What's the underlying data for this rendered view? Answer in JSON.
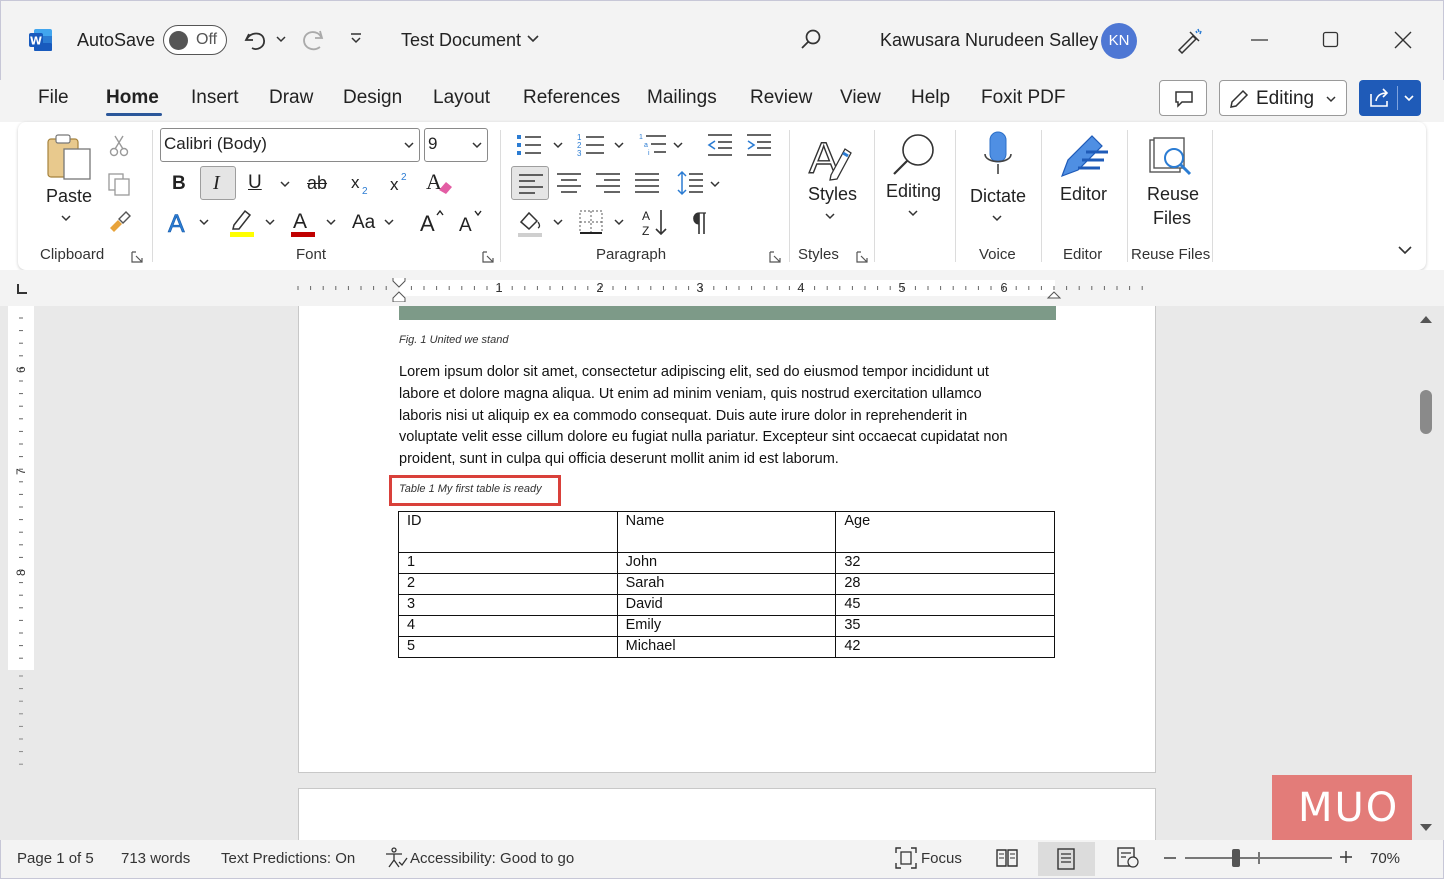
{
  "titlebar": {
    "autosave_label": "AutoSave",
    "autosave_state": "Off",
    "doc_title": "Test Document",
    "user_name": "Kawusara Nurudeen Salley",
    "user_initials": "KN"
  },
  "tabs": [
    "File",
    "Home",
    "Insert",
    "Draw",
    "Design",
    "Layout",
    "References",
    "Mailings",
    "Review",
    "View",
    "Help",
    "Foxit PDF"
  ],
  "active_tab": "Home",
  "editing_label": "Editing",
  "ribbon": {
    "paste_label": "Paste",
    "font_name": "Calibri (Body)",
    "font_size": "9",
    "styles_label": "Styles",
    "editing_label": "Editing",
    "dictate_label": "Dictate",
    "editor_label": "Editor",
    "reuse_label_1": "Reuse",
    "reuse_label_2": "Files",
    "groups": {
      "clipboard": "Clipboard",
      "font": "Font",
      "paragraph": "Paragraph",
      "styles": "Styles",
      "voice": "Voice",
      "editor": "Editor",
      "reuse": "Reuse Files"
    },
    "bold": "B",
    "italic": "I",
    "underline": "U",
    "strike": "ab",
    "change_case": "Aa"
  },
  "ruler_numbers": [
    "1",
    "2",
    "3",
    "4",
    "5",
    "6"
  ],
  "vruler_numbers": [
    "6",
    "7",
    "8"
  ],
  "document": {
    "fig_caption": "Fig. 1 United we stand",
    "para_lines": [
      "Lorem ipsum dolor sit amet, consectetur adipiscing elit, sed do eiusmod tempor incididunt ut",
      "labore et dolore magna aliqua. Ut enim ad minim veniam, quis nostrud exercitation ullamco",
      "laboris nisi ut aliquip ex ea commodo consequat. Duis aute irure dolor in reprehenderit in",
      "voluptate velit esse cillum dolore eu fugiat nulla pariatur. Excepteur sint occaecat cupidatat non",
      "proident, sunt in culpa qui officia deserunt mollit anim id est laborum."
    ],
    "table_caption": "Table 1 My first table is ready",
    "table_headers": [
      "ID",
      "Name",
      "Age"
    ],
    "table_rows": [
      [
        "1",
        "John",
        "32"
      ],
      [
        "2",
        "Sarah",
        "28"
      ],
      [
        "3",
        "David",
        "45"
      ],
      [
        "4",
        "Emily",
        "35"
      ],
      [
        "5",
        "Michael",
        "42"
      ]
    ]
  },
  "status": {
    "page": "Page 1 of 5",
    "words": "713 words",
    "predictions": "Text Predictions: On",
    "accessibility": "Accessibility: Good to go",
    "focus": "Focus",
    "zoom": "70%"
  },
  "watermark": "MUO",
  "colors": {
    "accent": "#2b579a",
    "share": "#1f5bb8",
    "highlight_red": "#d9403a",
    "avatar": "#4e77d4"
  }
}
